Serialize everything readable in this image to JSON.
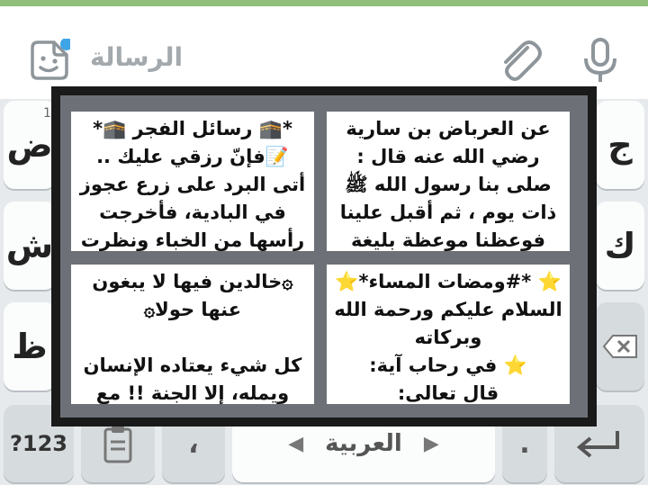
{
  "input": {
    "placeholder": "الرسالة",
    "accent_color": "#3fa4e6"
  },
  "icons": [
    "sticker-icon",
    "paperclip-icon",
    "microphone-icon",
    "backspace-icon",
    "enter-icon",
    "clipboard-icon",
    "arrow-left-icon",
    "arrow-right-icon"
  ],
  "keyboard": {
    "left_keys": [
      "ض",
      "ش",
      "ظ"
    ],
    "left_hint": "1",
    "right_keys": [
      "ج",
      "ك"
    ],
    "mode_key": "?123",
    "space_label": "العربية",
    "comma_key": "،",
    "dot_key": "."
  },
  "clips": [
    {
      "text": "عن العرباض بن سارية\nرضي الله عنه قال :\nصلى بنا رسول الله ﷺ\nذات يوم ، ثم أقبل علينا\nفوعظنا موعظة بليغة"
    },
    {
      "text": "*🕋 رسائل الفجر 🕋*\n📝فإنّ رزقي عليك ..\nأتى البرد على زرع عجوز\nفي البادية، فأخرجت\nرأسها من الخباء ونظرت"
    },
    {
      "text": "⭐ *#ومضات المساء*⭐\nالسلام عليكم ورحمة الله\nوبركاته\n⭐ في رحاب آية:\nقال تعالى:"
    },
    {
      "text": "۞خالدين فيها لا يبغون\nعنها حولا۞\n\nكل شيء يعتاده الإنسان\nويمله، إلا الجنة !! مع"
    }
  ]
}
